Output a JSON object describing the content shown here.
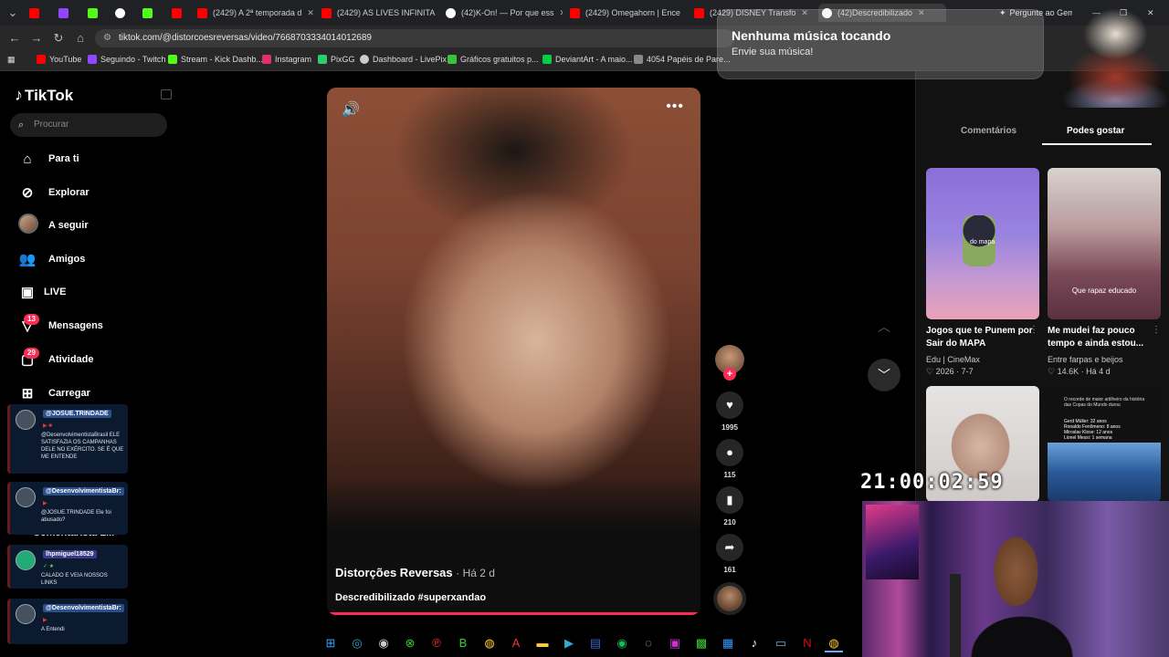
{
  "browser": {
    "tabs": [
      {
        "title": "",
        "color": "#ff0000"
      },
      {
        "title": "",
        "color": "#9146ff"
      },
      {
        "title": "",
        "color": "#53fc18"
      },
      {
        "title": "",
        "color": "#ffffff"
      },
      {
        "title": "",
        "color": "#53fc18"
      },
      {
        "title": "",
        "color": "#ff0000"
      },
      {
        "title": "(2429) A 2ª temporada d",
        "color": "#ff0000"
      },
      {
        "title": "(2429) AS LIVES INFINITA",
        "color": "#ff0000"
      },
      {
        "title": "(42)K-On! — Por que ess",
        "color": "#ffffff"
      },
      {
        "title": "(2429) Omegahorn | Ence",
        "color": "#ff0000"
      },
      {
        "title": "(2429) DISNEY Transfo",
        "color": "#ff0000"
      },
      {
        "title": "(42)Descredibilizado",
        "color": "#ffffff"
      }
    ],
    "gemini_label": "Pergunte ao Gemini",
    "url": "tiktok.com/@distorcoesreversas/video/7668703334014012689",
    "bookmarks": [
      {
        "label": "YouTube",
        "color": "#ff0000"
      },
      {
        "label": "Seguindo - Twitch",
        "color": "#9146ff"
      },
      {
        "label": "Stream - Kick Dashb...",
        "color": "#53fc18"
      },
      {
        "label": "Instagram",
        "color": "#e1306c"
      },
      {
        "label": "PixGG",
        "color": "#2ecc71"
      },
      {
        "label": "Dashboard - LivePix",
        "color": "#cccccc"
      },
      {
        "label": "Gráficos gratuitos p...",
        "color": "#3fbf3f"
      },
      {
        "label": "DeviantArt - A maio...",
        "color": "#05cc47"
      },
      {
        "label": "4054 Papéis de Pare...",
        "color": "#888888"
      }
    ]
  },
  "tiktok": {
    "logo": "TikTok",
    "search_placeholder": "Procurar",
    "nav": [
      {
        "label": "Para ti",
        "icon": "home-icon"
      },
      {
        "label": "Explorar",
        "icon": "compass-icon"
      },
      {
        "label": "A seguir",
        "icon": "avatar-icon"
      },
      {
        "label": "Amigos",
        "icon": "friends-icon"
      },
      {
        "label": "LIVE",
        "icon": "live-icon"
      },
      {
        "label": "Mensagens",
        "icon": "messages-icon",
        "badge": "13"
      },
      {
        "label": "Atividade",
        "icon": "activity-icon",
        "badge": "29"
      },
      {
        "label": "Carregar",
        "icon": "upload-icon"
      }
    ],
    "video": {
      "author": "Distorções Reversas",
      "age": "· Há 2 d",
      "caption": "Descredibilizado #superxandao",
      "likes": "1995",
      "comments": "115",
      "saves": "210",
      "shares": "161"
    },
    "right_panel": {
      "tabs": [
        "Comentários",
        "Podes gostar"
      ],
      "active_tab": "Podes gostar",
      "cards": [
        {
          "title": "Jogos que te Punem por Sair do MAPA",
          "author": "Edu | CineMax",
          "likes": "2026",
          "age": "7-7",
          "overlay": "do mapa"
        },
        {
          "title": "Me mudei faz pouco tempo e ainda estou...",
          "author": "Entre farpas e beijos",
          "likes": "14.6K",
          "age": "Há 4 d",
          "overlay": "Que rapaz educado"
        },
        {
          "title": "",
          "author": "",
          "likes": "",
          "age": "",
          "overlay": ""
        },
        {
          "title": "",
          "author": "",
          "likes": "",
          "age": "",
          "overlay": "O recorde de maior artilheiro da história das Copas do Mundo durou"
        }
      ],
      "ranking_lines": [
        "Gerd Müller: 32 anos",
        "Ronaldo Fenômeno: 8 anos",
        "Miroslav Klose: 12 anos",
        "Lionel Messi: 1 semana"
      ]
    }
  },
  "notification": {
    "title": "Nenhuma música tocando",
    "subtitle": "Envie sua música!"
  },
  "chat": [
    {
      "user": "@JOSUE.TRINDADE",
      "message": "@DesenvolvimentistaBrasil ELE SATISFAZIA OS CAMPANHAS DELE NO EXÉRCITO. SE É QUE ME ENTENDE"
    },
    {
      "user": "@DesenvolvimentistaBr:",
      "message": "@JOSUE.TRINDADE Ele foi abusado?"
    },
    {
      "user": "lhpmiguel18529",
      "message": "CALADO E VEIA NOSSOS LINKS"
    },
    {
      "user": "@DesenvolvimentistaBr:",
      "message": "A Entendi"
    }
  ],
  "overlay_behind_chat": "Comentarista L...",
  "stream": {
    "clock": "21:00:02:59"
  },
  "colors": {
    "accent": "#fe2c55",
    "chat_bg": "#0b1a2e",
    "chat_user_bg": "#2b4f8a"
  }
}
